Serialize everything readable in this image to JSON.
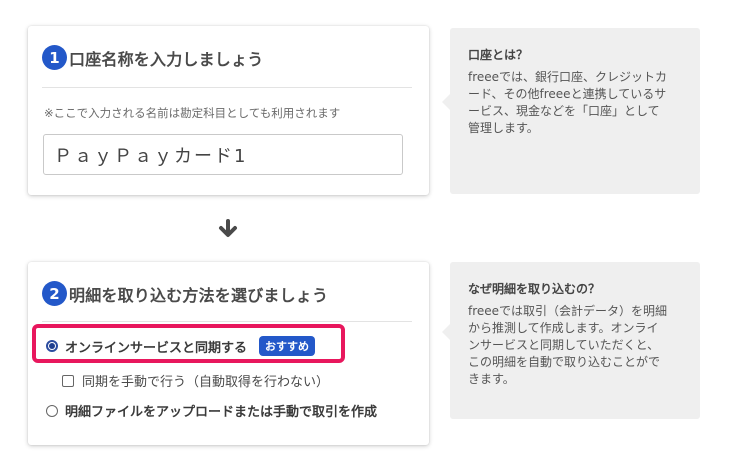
{
  "step1": {
    "number": "1",
    "title": "口座名称を入力しましょう",
    "note": "※ここで入力される名前は勘定科目としても利用されます",
    "input_value": "ＰａｙＰａｙカード1"
  },
  "step2": {
    "number": "2",
    "title": "明細を取り込む方法を選びましょう",
    "options": {
      "online": {
        "label": "オンラインサービスと同期する",
        "badge": "おすすめ",
        "selected": true
      },
      "manual_sync": {
        "label": "同期を手動で行う（自動取得を行わない）",
        "checked": false
      },
      "file": {
        "label": "明細ファイルをアップロードまたは手動で取引を作成",
        "selected": false
      }
    }
  },
  "help1": {
    "title": "口座とは？",
    "body": "freeeでは、銀行口座、クレジットカ\nード、その他freeeと連携しているサ\nービス、現金などを「口座」として\n管理します。"
  },
  "help2": {
    "title": "なぜ明細を取り込むの？",
    "body": "freeeでは取引（会計データ）を明細\nから推測して作成します。オンライ\nンサービスと同期していただくと、\nこの明細を自動で取り込むことがで\nきます。"
  },
  "colors": {
    "accent": "#2358c9",
    "highlight": "#e8175d",
    "help_bg": "#efefef"
  },
  "icons": {
    "arrow": "arrow-down-icon"
  }
}
